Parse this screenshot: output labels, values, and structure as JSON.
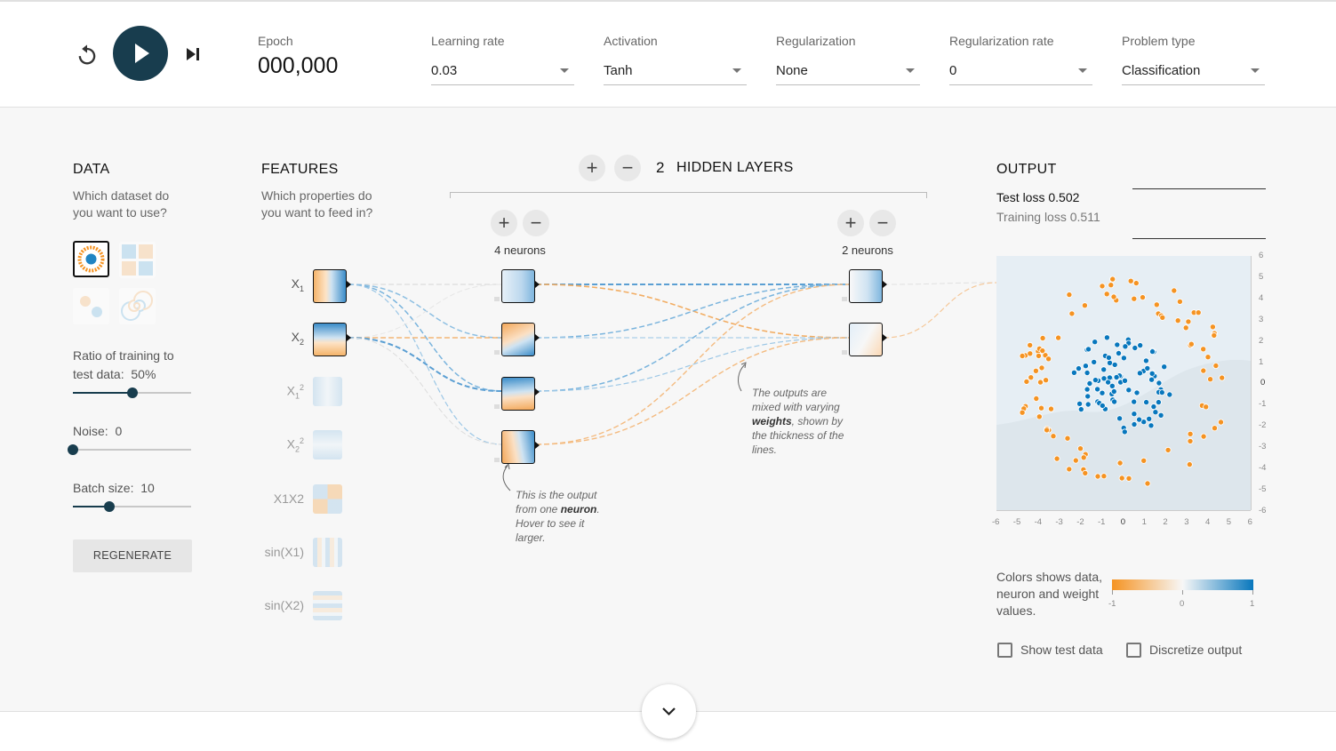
{
  "header": {
    "epoch_label": "Epoch",
    "epoch_value": "000,000",
    "learning_rate": {
      "label": "Learning rate",
      "value": "0.03"
    },
    "activation": {
      "label": "Activation",
      "value": "Tanh"
    },
    "regularization": {
      "label": "Regularization",
      "value": "None"
    },
    "regularization_rate": {
      "label": "Regularization rate",
      "value": "0"
    },
    "problem_type": {
      "label": "Problem type",
      "value": "Classification"
    }
  },
  "data_panel": {
    "heading": "DATA",
    "question": "Which dataset do you want to use?",
    "ratio_label": "Ratio of training to test data:",
    "ratio_value": "50%",
    "ratio_fraction": 0.5,
    "noise_label": "Noise:",
    "noise_value": "0",
    "noise_fraction": 0.0,
    "batch_label": "Batch size:",
    "batch_value": "10",
    "batch_fraction": 0.31,
    "regenerate_label": "REGENERATE"
  },
  "features_panel": {
    "heading": "FEATURES",
    "question": "Which properties do you want to feed in?",
    "features": [
      {
        "base": "X",
        "sub": "1",
        "sup": "",
        "active": true
      },
      {
        "base": "X",
        "sub": "2",
        "sup": "",
        "active": true
      },
      {
        "base": "X",
        "sub": "1",
        "sup": "2",
        "active": false
      },
      {
        "base": "X",
        "sub": "2",
        "sup": "2",
        "active": false
      },
      {
        "base": "X1X2",
        "sub": "",
        "sup": "",
        "active": false
      },
      {
        "base": "sin(X1)",
        "sub": "",
        "sup": "",
        "active": false
      },
      {
        "base": "sin(X2)",
        "sub": "",
        "sup": "",
        "active": false
      }
    ]
  },
  "network": {
    "hidden_layers_count": "2",
    "hidden_layers_label": "HIDDEN LAYERS",
    "layers": [
      {
        "neurons_label": "4 neurons"
      },
      {
        "neurons_label": "2 neurons"
      }
    ],
    "note_output": {
      "pre": "This is the output from one ",
      "bold": "neuron",
      "post": ". Hover to see it larger."
    },
    "note_weights": {
      "pre": "The outputs are mixed with varying ",
      "bold": "weights",
      "post": ", shown by the thickness of the lines."
    }
  },
  "output_panel": {
    "heading": "OUTPUT",
    "test_loss_label": "Test loss",
    "test_loss_value": "0.502",
    "training_loss_label": "Training loss",
    "training_loss_value": "0.511",
    "y_ticks": [
      "6",
      "5",
      "4",
      "3",
      "2",
      "1",
      "0",
      "-1",
      "-2",
      "-3",
      "-4",
      "-5",
      "-6"
    ],
    "x_ticks": [
      "-6",
      "-5",
      "-4",
      "-3",
      "-2",
      "-1",
      "0",
      "1",
      "2",
      "3",
      "4",
      "5",
      "6"
    ],
    "legend_text": "Colors shows data, neuron and weight values.",
    "legend_ticks": [
      "-1",
      "0",
      "1"
    ],
    "show_test_data_label": "Show test data",
    "discretize_label": "Discretize output"
  },
  "colors": {
    "orange": "#f59322",
    "blue": "#0877bd",
    "dark": "#183d4e"
  }
}
